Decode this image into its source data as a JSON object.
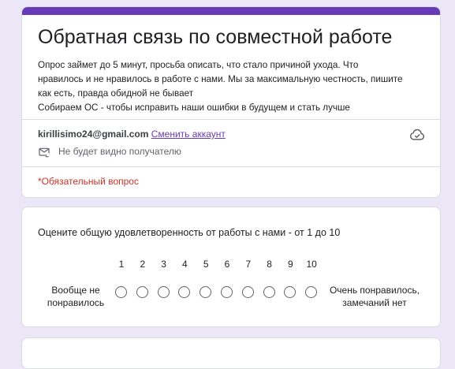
{
  "form": {
    "title": "Обратная связь по совместной работе",
    "description_lines": [
      "Опрос займет до 5 минут, просьба описать, что стало причиной ухода. Что",
      "нравилось и не нравилось в работе с нами. Мы за максимальную честность, пишите",
      "как есть, правда обидной не бывает",
      "Собираем ОС - чтобы исправить наши ошибки в будущем и стать лучше"
    ],
    "accent_color": "#673ab7",
    "background_color": "#ece7f6"
  },
  "account": {
    "email": "kirillisimo24@gmail.com",
    "switch_label": "Сменить аккаунт",
    "privacy_note": "Не будет видно получателю",
    "cloud_icon": "cloud-saved-icon",
    "mail_icon": "mail-icon"
  },
  "required_note": "*Обязательный вопрос",
  "required_color": "#d93025",
  "question": {
    "title": "Оцените общую удовлетворенность от работы с нами -  от 1 до 10",
    "scale_numbers": [
      "1",
      "2",
      "3",
      "4",
      "5",
      "6",
      "7",
      "8",
      "9",
      "10"
    ],
    "low_label": "Вообще не понравилось",
    "high_label": "Очень понравилось, замечаний нет",
    "selected": null
  }
}
